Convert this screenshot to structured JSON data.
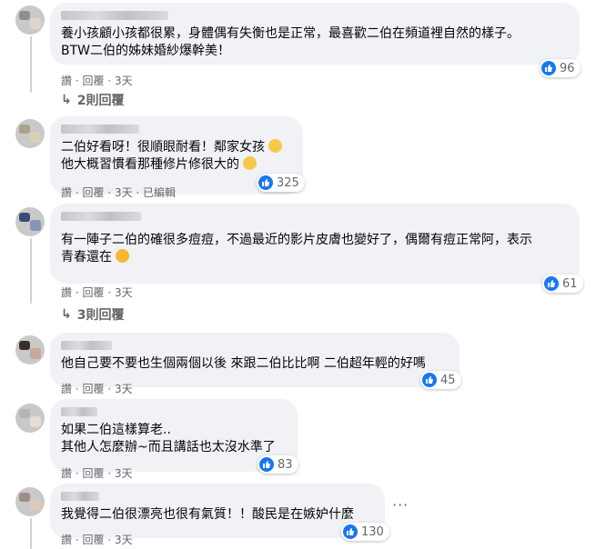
{
  "comments": [
    {
      "text": "養小孩顧小孩都很累，身體偶有失衡也是正常，最喜歡二伯在頻道裡自然的樣子。\nBTW二伯的姊妹婚紗爆幹美！",
      "actions": [
        "讚",
        "回覆",
        "3天"
      ],
      "reactions": "96",
      "replies": "2則回覆"
    },
    {
      "text_lines": [
        "二伯好看呀！很順眼耐看！鄰家女孩",
        "他大概習慣看那種修片修很大的"
      ],
      "actions": [
        "讚",
        "回覆",
        "3天",
        "已編輯"
      ],
      "reactions": "325"
    },
    {
      "text": "有一陣子二伯的確很多痘痘，不過最近的影片皮膚也變好了，偶爾有痘正常阿，表示\n青春還在",
      "actions": [
        "讚",
        "回覆",
        "3天"
      ],
      "reactions": "61",
      "replies": "3則回覆"
    },
    {
      "text": "他自己要不要也生個兩個以後 來跟二伯比比啊 二伯超年輕的好嗎",
      "actions": [
        "讚",
        "回覆",
        "3天"
      ],
      "reactions": "45"
    },
    {
      "text": "如果二伯這樣算老..\n其他人怎麼辦~而且講話也太沒水準了",
      "actions": [
        "讚",
        "回覆",
        "3天"
      ],
      "reactions": "83"
    },
    {
      "text": "我覺得二伯很漂亮也很有氣質！！酸民是在嫉妒什麼",
      "actions": [
        "讚",
        "回覆",
        "3天"
      ],
      "reactions": "130",
      "more": "···"
    }
  ],
  "icons": {
    "like": "like-thumb-icon",
    "reply": "reply-arrow-icon",
    "emoji1": "smiling-emoji-icon",
    "emoji2": "grin-emoji-icon",
    "emoji3": "laughing-emoji-icon"
  },
  "colors": {
    "bubble": "#f0f2f5",
    "like": "#1877f2",
    "meta": "#65676b"
  }
}
